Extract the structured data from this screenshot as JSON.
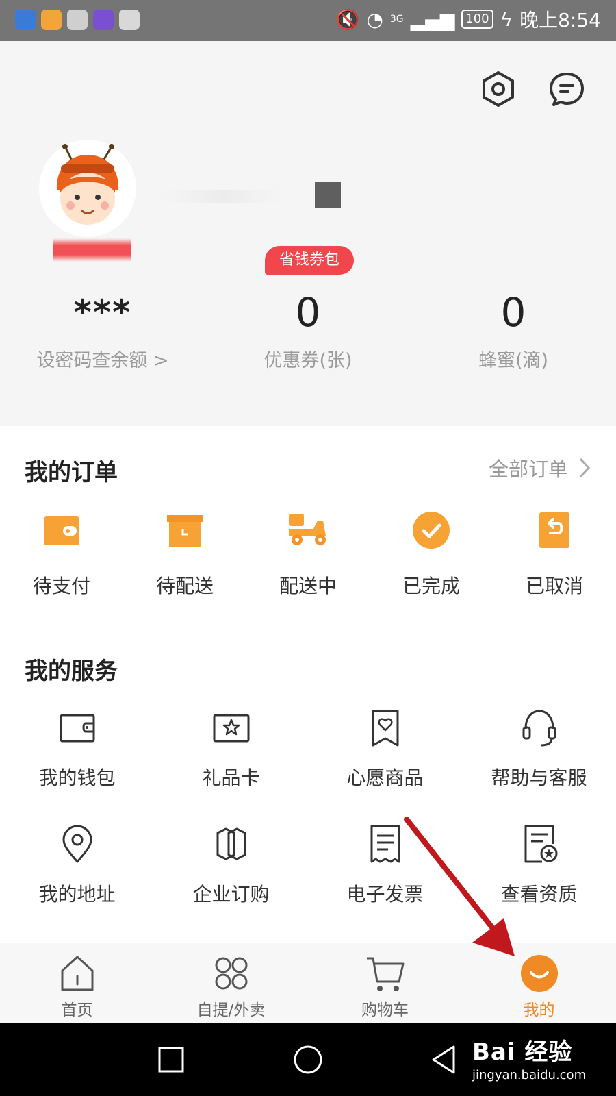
{
  "status_bar": {
    "battery": "100",
    "network": "3G",
    "time": "晚上8:54"
  },
  "header": {
    "settings_icon": "settings-hexagon-icon",
    "message_icon": "message-bubble-icon"
  },
  "profile": {
    "coupon_badge": "省钱券包",
    "stats": [
      {
        "value": "***",
        "label": "设密码查余额 >"
      },
      {
        "value": "0",
        "label": "优惠券(张)"
      },
      {
        "value": "0",
        "label": "蜂蜜(滴)"
      }
    ]
  },
  "orders": {
    "title": "我的订单",
    "all_label": "全部订单",
    "items": [
      {
        "label": "待支付",
        "icon": "wallet-icon"
      },
      {
        "label": "待配送",
        "icon": "box-icon"
      },
      {
        "label": "配送中",
        "icon": "scooter-icon"
      },
      {
        "label": "已完成",
        "icon": "check-circle-icon"
      },
      {
        "label": "已取消",
        "icon": "return-icon"
      }
    ]
  },
  "services": {
    "title": "我的服务",
    "rows": [
      [
        {
          "label": "我的钱包",
          "icon": "wallet-icon"
        },
        {
          "label": "礼品卡",
          "icon": "gift-card-icon"
        },
        {
          "label": "心愿商品",
          "icon": "wishlist-icon"
        },
        {
          "label": "帮助与客服",
          "icon": "headset-icon"
        }
      ],
      [
        {
          "label": "我的地址",
          "icon": "location-pin-icon"
        },
        {
          "label": "企业订购",
          "icon": "enterprise-icon"
        },
        {
          "label": "电子发票",
          "icon": "invoice-icon"
        },
        {
          "label": "查看资质",
          "icon": "certificate-icon"
        }
      ]
    ]
  },
  "tabbar": {
    "items": [
      {
        "label": "首页",
        "icon": "home-icon"
      },
      {
        "label": "自提/外卖",
        "icon": "grid-icon"
      },
      {
        "label": "购物车",
        "icon": "cart-icon"
      },
      {
        "label": "我的",
        "icon": "smile-icon",
        "active": true
      }
    ]
  },
  "watermark": {
    "main": "Bai 经验",
    "sub": "jingyan.baidu.com"
  },
  "colors": {
    "accent": "#f08a24",
    "order_icon": "#f7a235",
    "badge_red": "#f0464c",
    "arrow_red": "#c0181c"
  }
}
